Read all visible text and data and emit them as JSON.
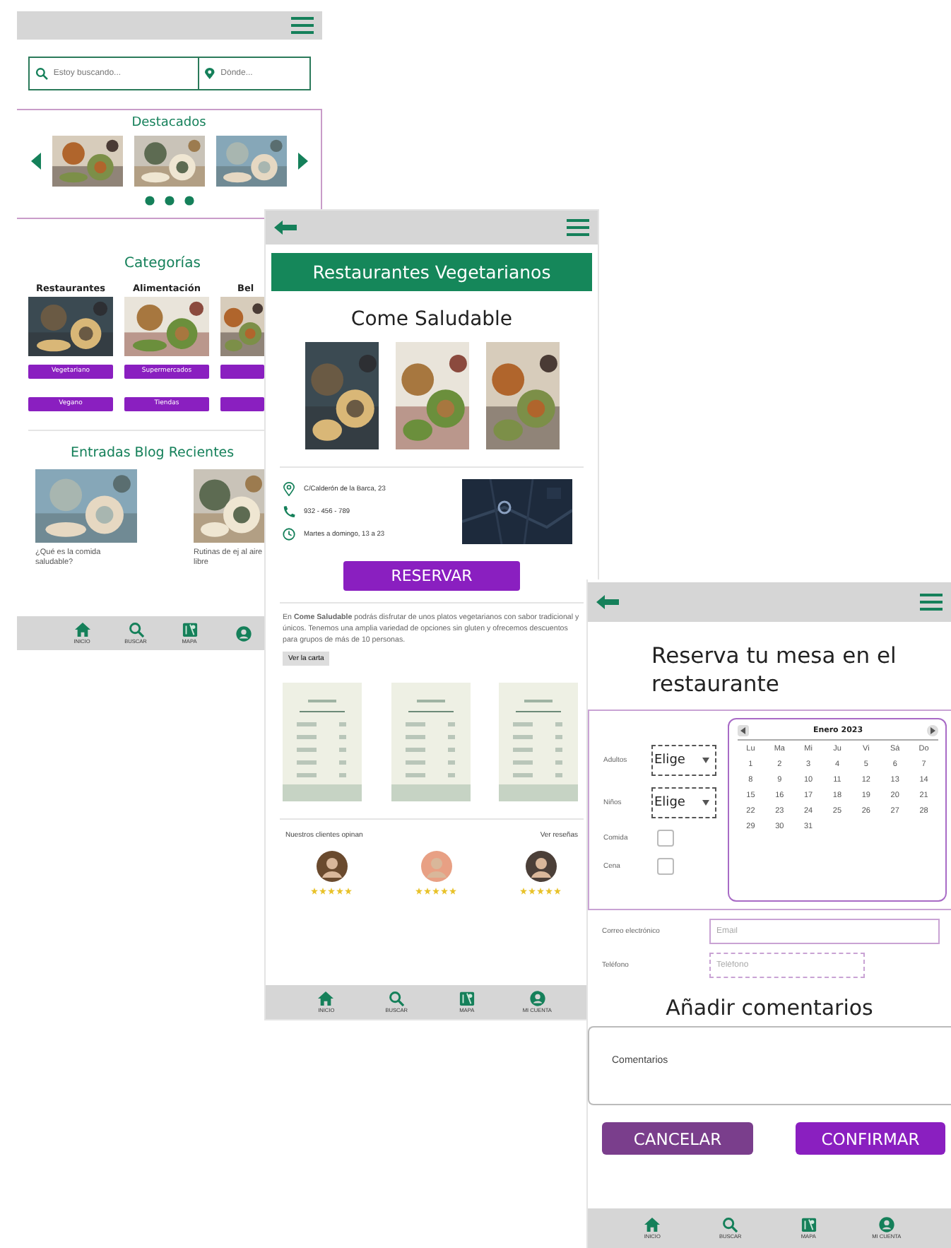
{
  "home": {
    "search": {
      "placeholder": "Estoy buscando...",
      "location_placeholder": "Dónde..."
    },
    "featured": {
      "title": "Destacados"
    },
    "categories": {
      "title": "Categorías",
      "columns": [
        {
          "label": "Restaurantes",
          "tags": [
            "Vegetariano",
            "Vegano"
          ]
        },
        {
          "label": "Alimentación",
          "tags": [
            "Supermercados",
            "Tiendas"
          ]
        },
        {
          "label": "Bel"
        }
      ]
    },
    "blog": {
      "title": "Entradas Blog Recientes",
      "posts": [
        {
          "caption": "¿Qué es la comida saludable?"
        },
        {
          "caption": "Rutinas de ej al aire libre"
        }
      ]
    },
    "nav": [
      {
        "kind": "home",
        "label": "INICIO"
      },
      {
        "kind": "search",
        "label": "BUSCAR"
      },
      {
        "kind": "map",
        "label": "MAPA"
      },
      {
        "kind": "account"
      }
    ]
  },
  "restaurant": {
    "banner": "Restaurantes Vegetarianos",
    "name": "Come Saludable",
    "info": [
      {
        "kind": "address",
        "text": "C/Calderón de la Barca, 23"
      },
      {
        "kind": "phone",
        "text": "932 - 456 - 789"
      },
      {
        "kind": "hours",
        "text": "Martes a domingo, 13 a 23"
      }
    ],
    "reserve": "RESERVAR",
    "description": "En **Come Saludable** podrás disfrutar de unos platos vegetarianos con sabor tradicional y únicos. Tenemos una amplia variedad de opciones sin gluten y ofrecemos descuentos para grupos de más de 10 personas.",
    "menu_button": "Ver la carta",
    "reviews_title": "Nuestros clientes opinan",
    "reviews_link": "Ver reseñas",
    "reviews": [
      {
        "stars": 5
      },
      {
        "stars": 5
      },
      {
        "stars": 5
      }
    ],
    "nav": [
      {
        "kind": "home",
        "label": "INICIO"
      },
      {
        "kind": "search",
        "label": "BUSCAR"
      },
      {
        "kind": "map",
        "label": "MAPA"
      },
      {
        "kind": "account",
        "label": "MI CUENTA"
      }
    ]
  },
  "booking": {
    "title": "Reserva tu mesa en el restaurante",
    "fields": [
      {
        "kind": "select",
        "label": "Adultos",
        "value": "Elige"
      },
      {
        "kind": "select",
        "label": "Niños",
        "value": "Elige"
      },
      {
        "kind": "checkbox",
        "label": "Comida",
        "checked": false
      },
      {
        "kind": "checkbox",
        "label": "Cena",
        "checked": false
      }
    ],
    "calendar": {
      "month": "Enero 2023",
      "weekdays": [
        "Lu",
        "Ma",
        "Mi",
        "Ju",
        "Vi",
        "Sá",
        "Do"
      ],
      "days": [
        "1",
        "2",
        "3",
        "4",
        "5",
        "6",
        "7",
        "8",
        "9",
        "10",
        "11",
        "12",
        "13",
        "14",
        "15",
        "16",
        "17",
        "18",
        "19",
        "20",
        "21",
        "22",
        "23",
        "24",
        "25",
        "26",
        "27",
        "28",
        "29",
        "30",
        "31"
      ]
    },
    "contact": [
      {
        "label": "Correo electrónico",
        "placeholder": "Email"
      },
      {
        "label": "Teléfono",
        "placeholder": "Teléfono"
      }
    ],
    "comments_title": "Añadir comentarios",
    "comments": {
      "placeholder": "Comentarios"
    },
    "buttons": [
      {
        "kind": "cancel",
        "label": "CANCELAR"
      },
      {
        "kind": "confirm",
        "label": "CONFIRMAR"
      }
    ],
    "nav": [
      {
        "kind": "home",
        "label": "INICIO"
      },
      {
        "kind": "search",
        "label": "BUSCAR"
      },
      {
        "kind": "map",
        "label": "MAPA"
      },
      {
        "kind": "account",
        "label": "MI CUENTA"
      }
    ]
  }
}
